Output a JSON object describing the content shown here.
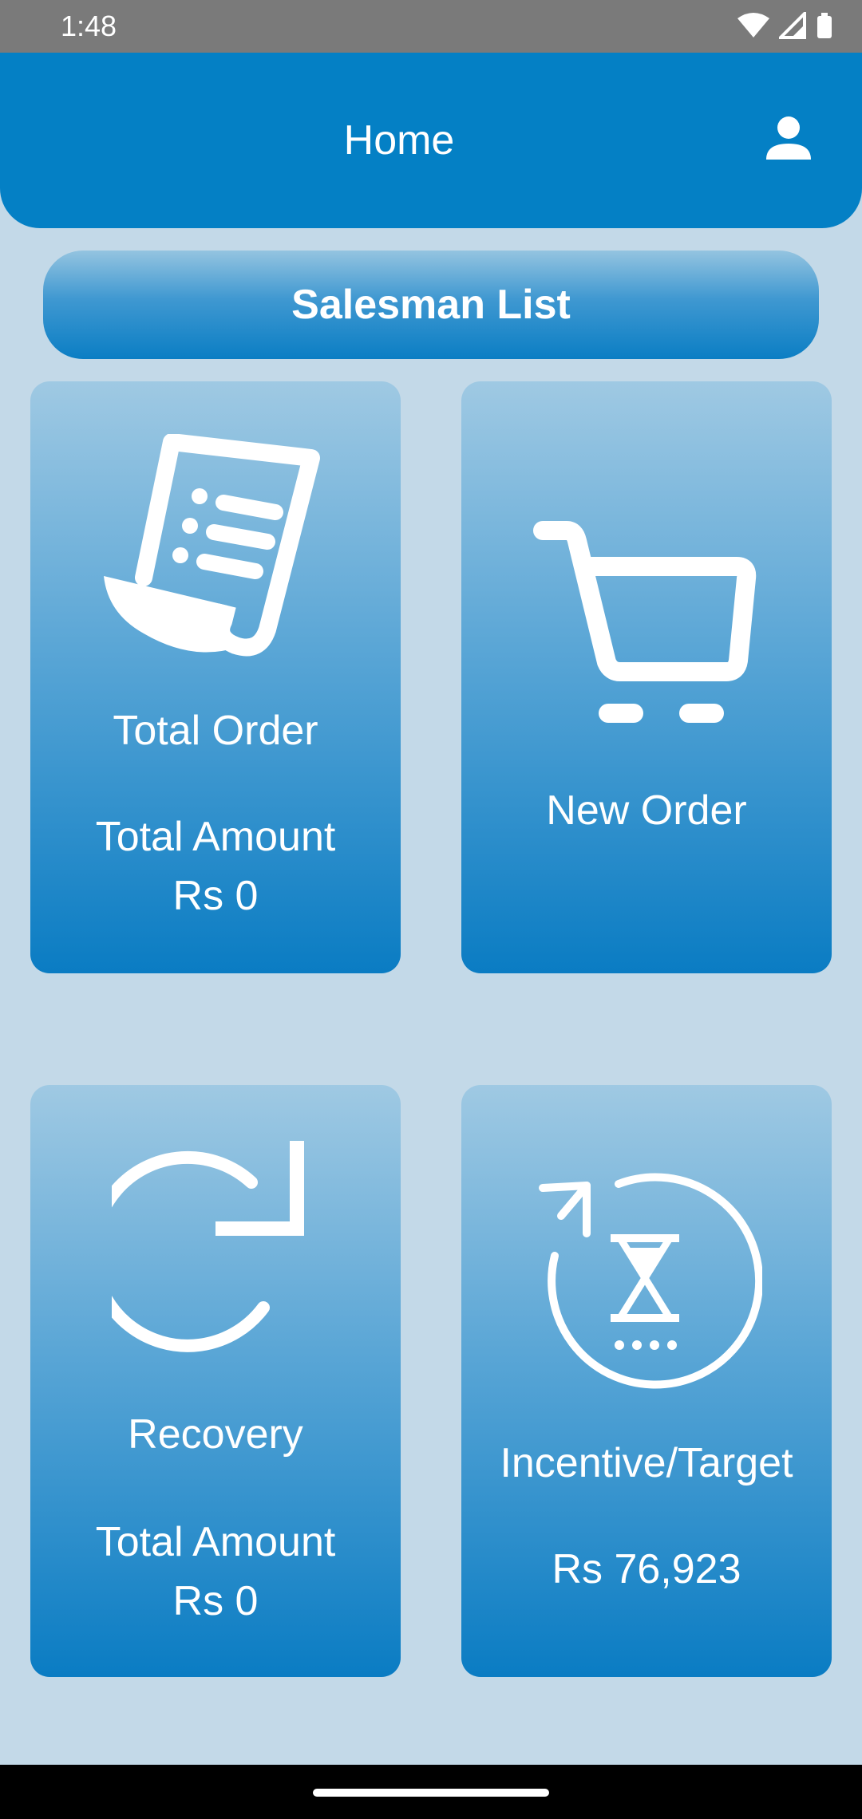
{
  "status_bar": {
    "time": "1:48"
  },
  "app_bar": {
    "title": "Home",
    "profile_icon": "person-icon"
  },
  "salesman_button": {
    "label": "Salesman List"
  },
  "cards": {
    "total_order": {
      "icon": "receipt-icon",
      "label": "Total Order",
      "amount_label": "Total Amount",
      "amount_value": "Rs 0"
    },
    "new_order": {
      "icon": "shopping-cart-icon",
      "label": "New Order"
    },
    "recovery": {
      "icon": "refresh-icon",
      "label": "Recovery",
      "amount_label": "Total Amount",
      "amount_value": "Rs 0"
    },
    "incentive": {
      "icon": "hourglass-cycle-icon",
      "label": "Incentive/Target",
      "amount_value": "Rs 76,923"
    }
  },
  "colors": {
    "app_bar": "#0480c5",
    "background": "#c3d9e8",
    "card_top": "#9fc9e3",
    "card_bottom": "#0a7cc3"
  }
}
